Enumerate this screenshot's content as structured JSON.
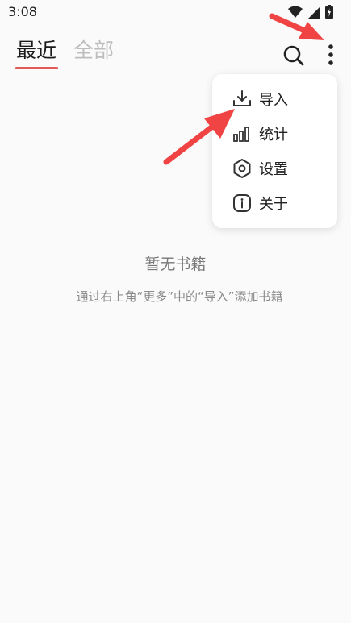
{
  "status_bar": {
    "time": "3:08",
    "icons": [
      "wifi-icon",
      "signal-icon",
      "battery-icon"
    ]
  },
  "header": {
    "tabs": [
      {
        "label": "最近",
        "active": true
      },
      {
        "label": "全部",
        "active": false
      }
    ],
    "actions": [
      "search-icon",
      "more-vertical-icon"
    ]
  },
  "menu": {
    "items": [
      {
        "label": "导入",
        "icon": "import-icon"
      },
      {
        "label": "统计",
        "icon": "bar-chart-icon"
      },
      {
        "label": "设置",
        "icon": "settings-hexagon-icon"
      },
      {
        "label": "关于",
        "icon": "info-icon"
      }
    ]
  },
  "empty_state": {
    "title": "暂无书籍",
    "hint": "通过右上角“更多”中的“导入”添加书籍"
  },
  "colors": {
    "accent": "#e05a5a",
    "annotation_arrow": "#f04444",
    "background": "#fafafa"
  }
}
